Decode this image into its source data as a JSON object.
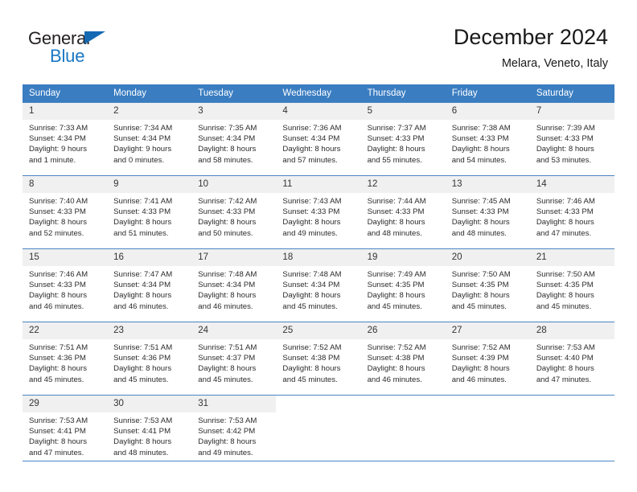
{
  "brand": {
    "name_part1": "General",
    "name_part2": "Blue",
    "color_dark": "#231f20",
    "color_blue": "#1877c4"
  },
  "header": {
    "title": "December 2024",
    "subtitle": "Melara, Veneto, Italy"
  },
  "theme": {
    "header_row_bg": "#3a7dc1",
    "header_row_text": "#ffffff",
    "daynum_bg": "#f0f0f0",
    "grid_line": "#4a85c4"
  },
  "weekday_headers": [
    "Sunday",
    "Monday",
    "Tuesday",
    "Wednesday",
    "Thursday",
    "Friday",
    "Saturday"
  ],
  "weeks": [
    [
      {
        "day": "1",
        "sunrise": "Sunrise: 7:33 AM",
        "sunset": "Sunset: 4:34 PM",
        "daylight_line1": "Daylight: 9 hours",
        "daylight_line2": "and 1 minute."
      },
      {
        "day": "2",
        "sunrise": "Sunrise: 7:34 AM",
        "sunset": "Sunset: 4:34 PM",
        "daylight_line1": "Daylight: 9 hours",
        "daylight_line2": "and 0 minutes."
      },
      {
        "day": "3",
        "sunrise": "Sunrise: 7:35 AM",
        "sunset": "Sunset: 4:34 PM",
        "daylight_line1": "Daylight: 8 hours",
        "daylight_line2": "and 58 minutes."
      },
      {
        "day": "4",
        "sunrise": "Sunrise: 7:36 AM",
        "sunset": "Sunset: 4:34 PM",
        "daylight_line1": "Daylight: 8 hours",
        "daylight_line2": "and 57 minutes."
      },
      {
        "day": "5",
        "sunrise": "Sunrise: 7:37 AM",
        "sunset": "Sunset: 4:33 PM",
        "daylight_line1": "Daylight: 8 hours",
        "daylight_line2": "and 55 minutes."
      },
      {
        "day": "6",
        "sunrise": "Sunrise: 7:38 AM",
        "sunset": "Sunset: 4:33 PM",
        "daylight_line1": "Daylight: 8 hours",
        "daylight_line2": "and 54 minutes."
      },
      {
        "day": "7",
        "sunrise": "Sunrise: 7:39 AM",
        "sunset": "Sunset: 4:33 PM",
        "daylight_line1": "Daylight: 8 hours",
        "daylight_line2": "and 53 minutes."
      }
    ],
    [
      {
        "day": "8",
        "sunrise": "Sunrise: 7:40 AM",
        "sunset": "Sunset: 4:33 PM",
        "daylight_line1": "Daylight: 8 hours",
        "daylight_line2": "and 52 minutes."
      },
      {
        "day": "9",
        "sunrise": "Sunrise: 7:41 AM",
        "sunset": "Sunset: 4:33 PM",
        "daylight_line1": "Daylight: 8 hours",
        "daylight_line2": "and 51 minutes."
      },
      {
        "day": "10",
        "sunrise": "Sunrise: 7:42 AM",
        "sunset": "Sunset: 4:33 PM",
        "daylight_line1": "Daylight: 8 hours",
        "daylight_line2": "and 50 minutes."
      },
      {
        "day": "11",
        "sunrise": "Sunrise: 7:43 AM",
        "sunset": "Sunset: 4:33 PM",
        "daylight_line1": "Daylight: 8 hours",
        "daylight_line2": "and 49 minutes."
      },
      {
        "day": "12",
        "sunrise": "Sunrise: 7:44 AM",
        "sunset": "Sunset: 4:33 PM",
        "daylight_line1": "Daylight: 8 hours",
        "daylight_line2": "and 48 minutes."
      },
      {
        "day": "13",
        "sunrise": "Sunrise: 7:45 AM",
        "sunset": "Sunset: 4:33 PM",
        "daylight_line1": "Daylight: 8 hours",
        "daylight_line2": "and 48 minutes."
      },
      {
        "day": "14",
        "sunrise": "Sunrise: 7:46 AM",
        "sunset": "Sunset: 4:33 PM",
        "daylight_line1": "Daylight: 8 hours",
        "daylight_line2": "and 47 minutes."
      }
    ],
    [
      {
        "day": "15",
        "sunrise": "Sunrise: 7:46 AM",
        "sunset": "Sunset: 4:33 PM",
        "daylight_line1": "Daylight: 8 hours",
        "daylight_line2": "and 46 minutes."
      },
      {
        "day": "16",
        "sunrise": "Sunrise: 7:47 AM",
        "sunset": "Sunset: 4:34 PM",
        "daylight_line1": "Daylight: 8 hours",
        "daylight_line2": "and 46 minutes."
      },
      {
        "day": "17",
        "sunrise": "Sunrise: 7:48 AM",
        "sunset": "Sunset: 4:34 PM",
        "daylight_line1": "Daylight: 8 hours",
        "daylight_line2": "and 46 minutes."
      },
      {
        "day": "18",
        "sunrise": "Sunrise: 7:48 AM",
        "sunset": "Sunset: 4:34 PM",
        "daylight_line1": "Daylight: 8 hours",
        "daylight_line2": "and 45 minutes."
      },
      {
        "day": "19",
        "sunrise": "Sunrise: 7:49 AM",
        "sunset": "Sunset: 4:35 PM",
        "daylight_line1": "Daylight: 8 hours",
        "daylight_line2": "and 45 minutes."
      },
      {
        "day": "20",
        "sunrise": "Sunrise: 7:50 AM",
        "sunset": "Sunset: 4:35 PM",
        "daylight_line1": "Daylight: 8 hours",
        "daylight_line2": "and 45 minutes."
      },
      {
        "day": "21",
        "sunrise": "Sunrise: 7:50 AM",
        "sunset": "Sunset: 4:35 PM",
        "daylight_line1": "Daylight: 8 hours",
        "daylight_line2": "and 45 minutes."
      }
    ],
    [
      {
        "day": "22",
        "sunrise": "Sunrise: 7:51 AM",
        "sunset": "Sunset: 4:36 PM",
        "daylight_line1": "Daylight: 8 hours",
        "daylight_line2": "and 45 minutes."
      },
      {
        "day": "23",
        "sunrise": "Sunrise: 7:51 AM",
        "sunset": "Sunset: 4:36 PM",
        "daylight_line1": "Daylight: 8 hours",
        "daylight_line2": "and 45 minutes."
      },
      {
        "day": "24",
        "sunrise": "Sunrise: 7:51 AM",
        "sunset": "Sunset: 4:37 PM",
        "daylight_line1": "Daylight: 8 hours",
        "daylight_line2": "and 45 minutes."
      },
      {
        "day": "25",
        "sunrise": "Sunrise: 7:52 AM",
        "sunset": "Sunset: 4:38 PM",
        "daylight_line1": "Daylight: 8 hours",
        "daylight_line2": "and 45 minutes."
      },
      {
        "day": "26",
        "sunrise": "Sunrise: 7:52 AM",
        "sunset": "Sunset: 4:38 PM",
        "daylight_line1": "Daylight: 8 hours",
        "daylight_line2": "and 46 minutes."
      },
      {
        "day": "27",
        "sunrise": "Sunrise: 7:52 AM",
        "sunset": "Sunset: 4:39 PM",
        "daylight_line1": "Daylight: 8 hours",
        "daylight_line2": "and 46 minutes."
      },
      {
        "day": "28",
        "sunrise": "Sunrise: 7:53 AM",
        "sunset": "Sunset: 4:40 PM",
        "daylight_line1": "Daylight: 8 hours",
        "daylight_line2": "and 47 minutes."
      }
    ],
    [
      {
        "day": "29",
        "sunrise": "Sunrise: 7:53 AM",
        "sunset": "Sunset: 4:41 PM",
        "daylight_line1": "Daylight: 8 hours",
        "daylight_line2": "and 47 minutes."
      },
      {
        "day": "30",
        "sunrise": "Sunrise: 7:53 AM",
        "sunset": "Sunset: 4:41 PM",
        "daylight_line1": "Daylight: 8 hours",
        "daylight_line2": "and 48 minutes."
      },
      {
        "day": "31",
        "sunrise": "Sunrise: 7:53 AM",
        "sunset": "Sunset: 4:42 PM",
        "daylight_line1": "Daylight: 8 hours",
        "daylight_line2": "and 49 minutes."
      },
      null,
      null,
      null,
      null
    ]
  ]
}
